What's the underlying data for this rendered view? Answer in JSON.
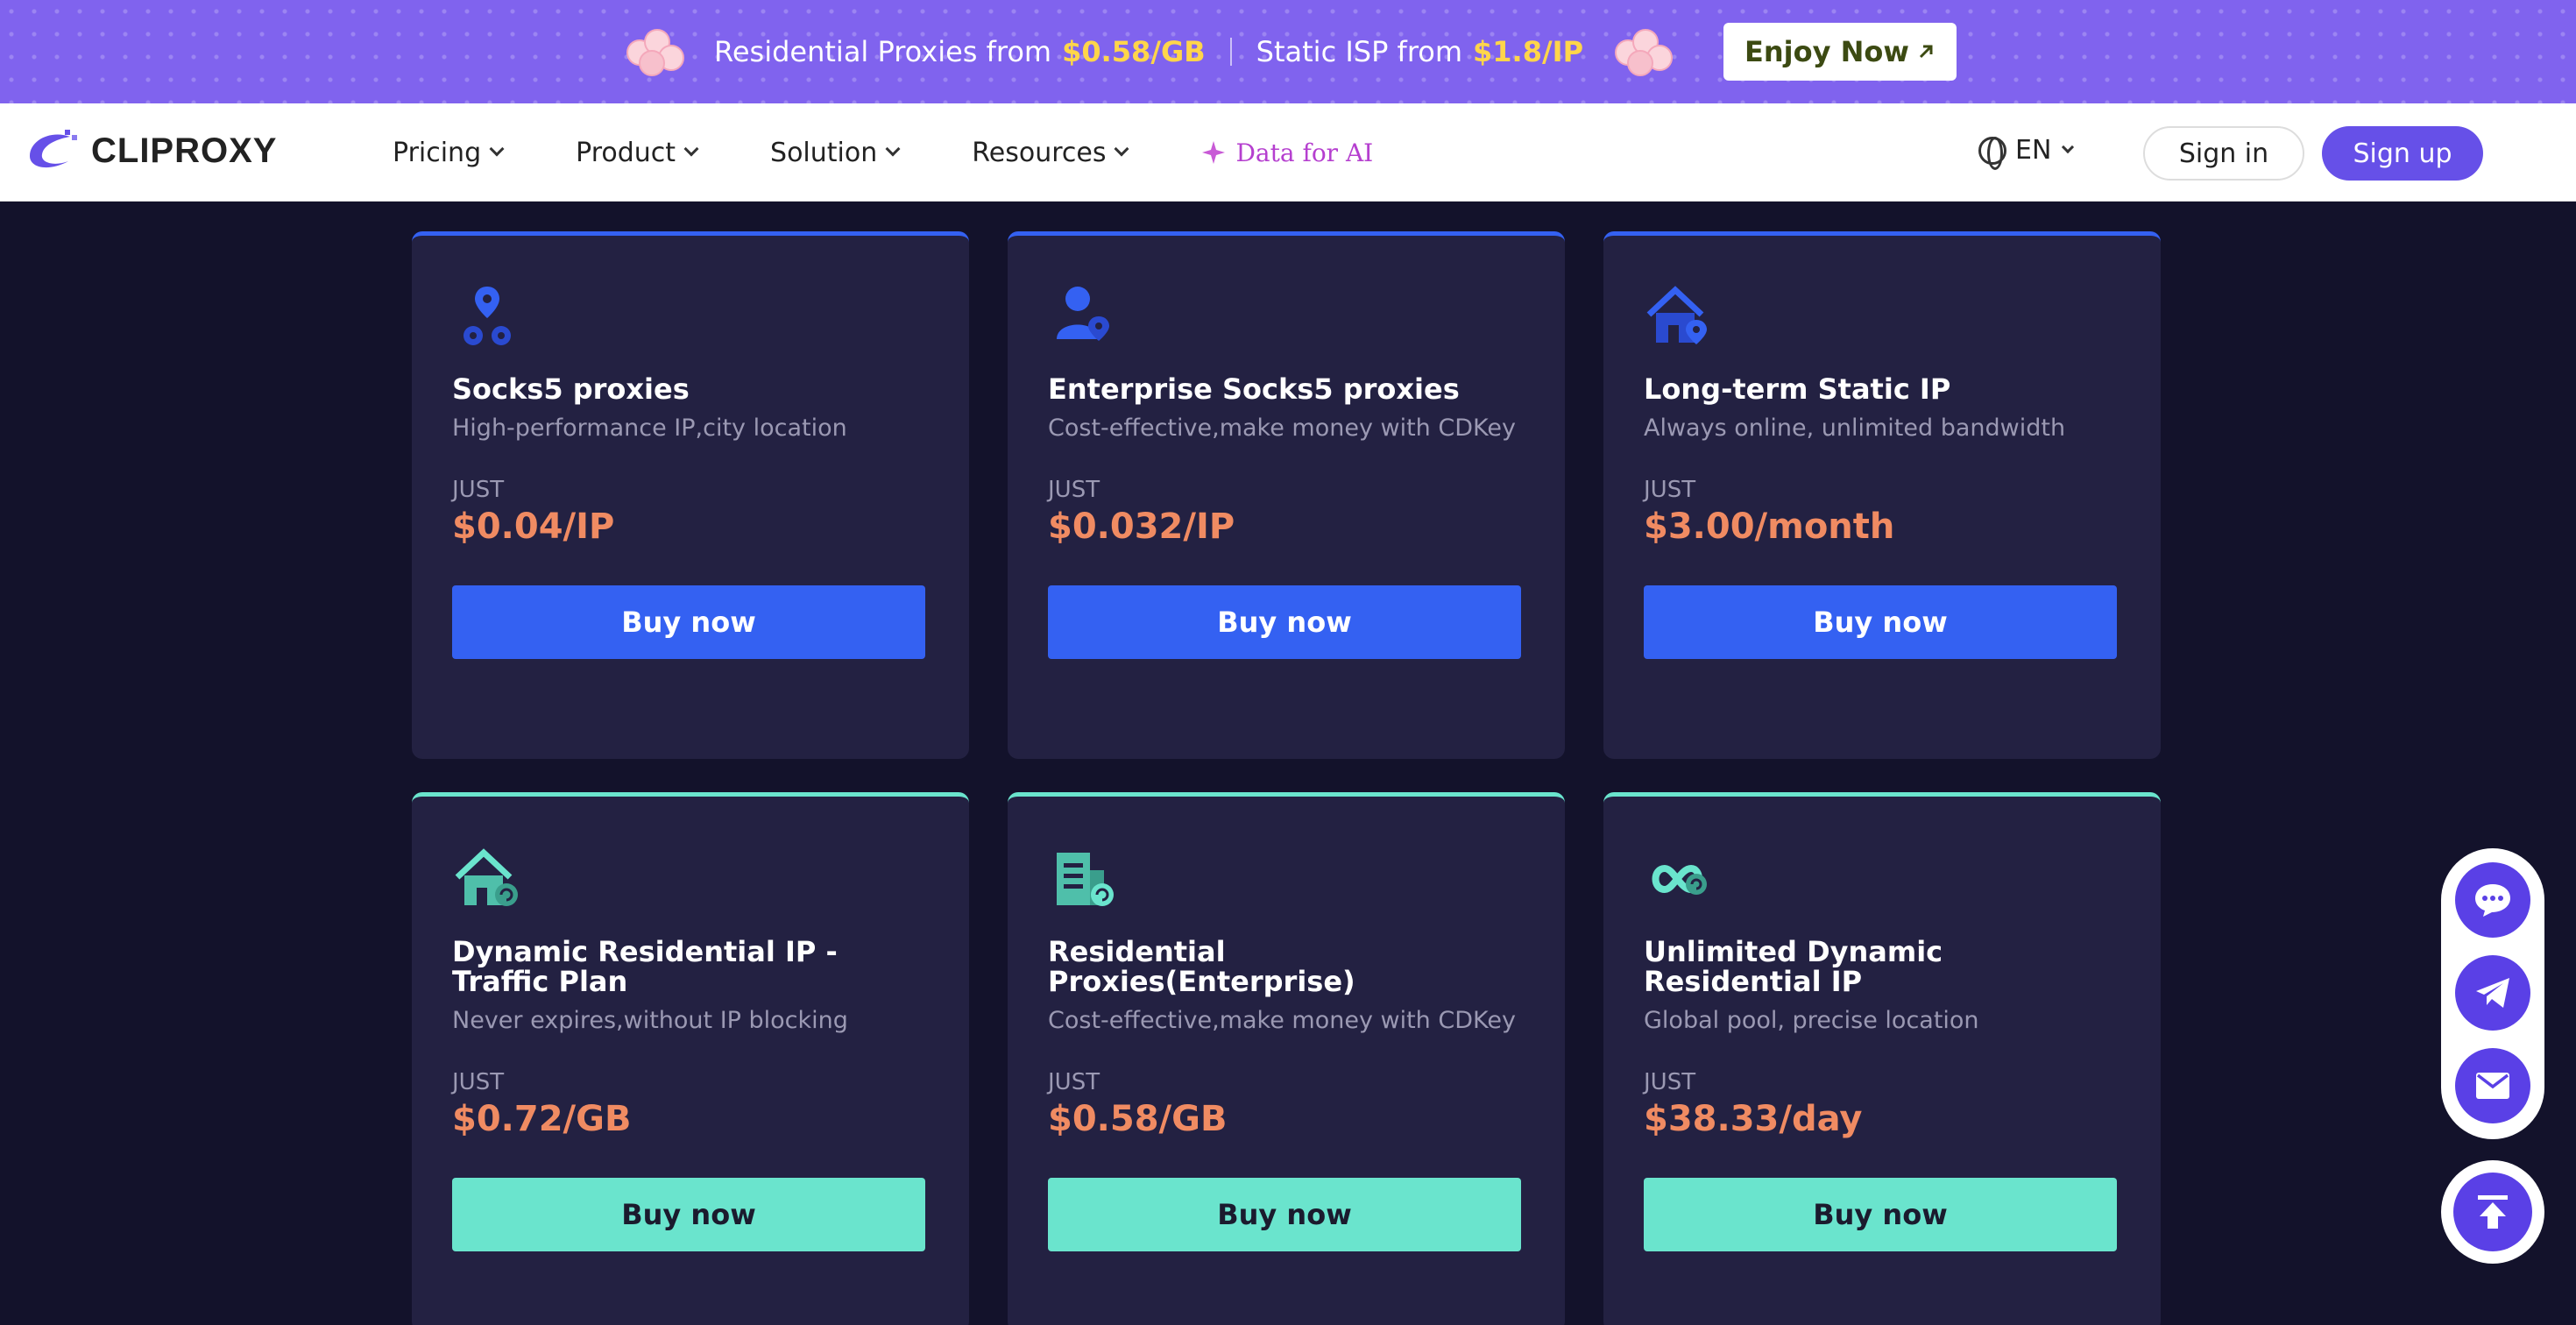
{
  "promo": {
    "text1": "Residential Proxies from",
    "price1": "$0.58/GB",
    "text2": "Static ISP from",
    "price2": "$1.8/IP",
    "cta": "Enjoy Now",
    "colors": {
      "bg": "#8063ee",
      "highlight": "#ffd54a"
    }
  },
  "nav": {
    "logo": "CLIPROXY",
    "menu": [
      {
        "label": "Pricing"
      },
      {
        "label": "Product"
      },
      {
        "label": "Solution"
      },
      {
        "label": "Resources"
      }
    ],
    "data_ai": "Data for AI",
    "language": "EN",
    "sign_in": "Sign in",
    "sign_up": "Sign up"
  },
  "cards": [
    {
      "title": "Socks5 proxies",
      "subtitle": "High-performance IP,city location",
      "just": "JUST",
      "price": "$0.04/IP",
      "button": "Buy now",
      "icon": "location-pins-icon",
      "theme": "blue"
    },
    {
      "title": "Enterprise Socks5 proxies",
      "subtitle": "Cost-effective,make money with CDKey",
      "just": "JUST",
      "price": "$0.032/IP",
      "button": "Buy now",
      "icon": "user-pin-icon",
      "theme": "blue"
    },
    {
      "title": "Long-term Static IP",
      "subtitle": "Always online, unlimited bandwidth",
      "just": "JUST",
      "price": "$3.00/month",
      "button": "Buy now",
      "icon": "house-pin-icon",
      "theme": "blue"
    },
    {
      "title": "Dynamic Residential IP - Traffic Plan",
      "subtitle": "Never expires,without IP blocking",
      "just": "JUST",
      "price": "$0.72/GB",
      "button": "Buy now",
      "icon": "house-refresh-icon",
      "theme": "teal"
    },
    {
      "title": "Residential Proxies(Enterprise)",
      "subtitle": "Cost-effective,make money with CDKey",
      "just": "JUST",
      "price": "$0.58/GB",
      "button": "Buy now",
      "icon": "building-refresh-icon",
      "theme": "teal"
    },
    {
      "title": "Unlimited Dynamic Residential IP",
      "subtitle": "Global pool, precise location",
      "just": "JUST",
      "price": "$38.33/day",
      "button": "Buy now",
      "icon": "infinity-refresh-icon",
      "theme": "teal"
    }
  ],
  "float": {
    "icons": [
      "chat-icon",
      "telegram-icon",
      "mail-icon",
      "back-to-top-icon"
    ]
  },
  "colors": {
    "page_bg": "#13122b",
    "card_bg": "#232142",
    "blue": "#3461f2",
    "teal": "#6ae4cd",
    "price": "#f08b62",
    "accent": "#6650e8"
  }
}
